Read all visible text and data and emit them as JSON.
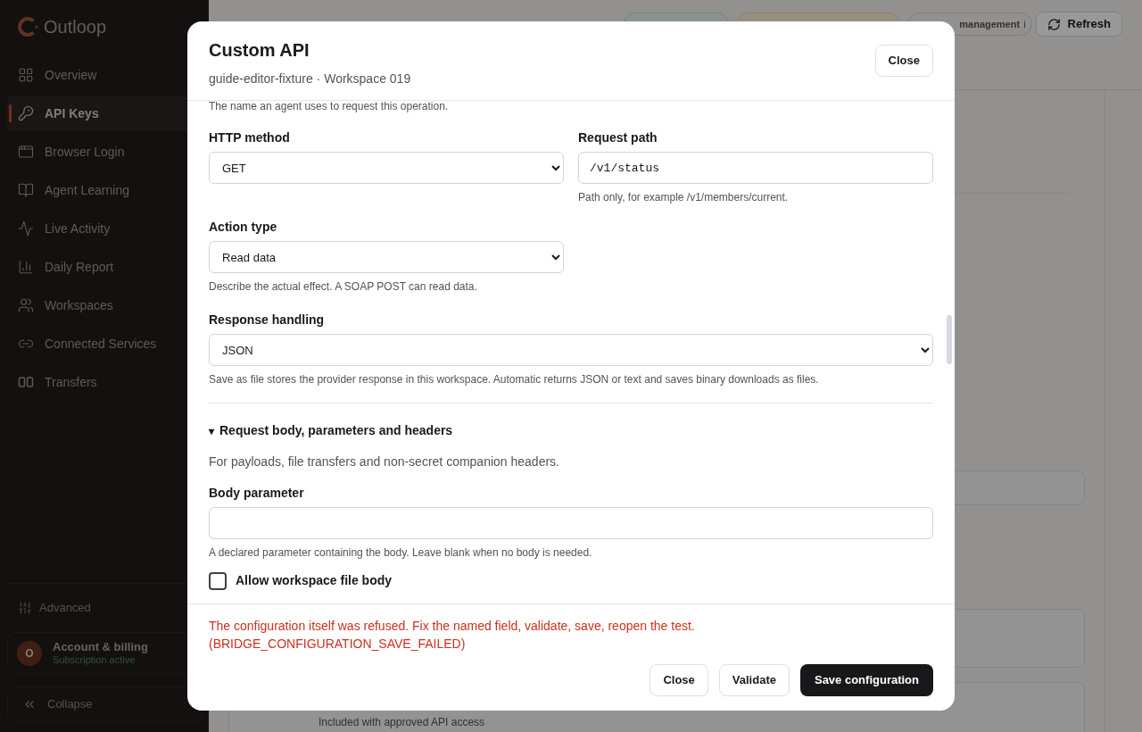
{
  "sidebar": {
    "logo": "Outloop",
    "items": [
      {
        "label": "Overview",
        "selected": false
      },
      {
        "label": "API Keys",
        "selected": true
      },
      {
        "label": "Browser Login",
        "selected": false
      },
      {
        "label": "Agent Learning",
        "selected": false
      },
      {
        "label": "Live Activity",
        "selected": false
      },
      {
        "label": "Daily Report",
        "selected": false
      },
      {
        "label": "Workspaces",
        "selected": false
      },
      {
        "label": "Connected Services",
        "selected": false
      },
      {
        "label": "Transfers",
        "selected": false
      }
    ],
    "advanced": "Advanced",
    "account": {
      "initial": "O",
      "name": "Account & billing",
      "status": "Subscription active"
    },
    "collapse": "Collapse"
  },
  "page": {
    "badge": "management",
    "badge_info": "i",
    "refresh": "Refresh",
    "note": "Included with approved API access"
  },
  "dialog": {
    "title": "Custom API",
    "subtitle": "guide-editor-fixture · Workspace 019",
    "close": "Close",
    "top_hint": "The name an agent uses to request this operation.",
    "method": {
      "label": "HTTP method",
      "value": "GET"
    },
    "path": {
      "label": "Request path",
      "value": "/v1/status",
      "hint": "Path only, for example /v1/members/current."
    },
    "action_type": {
      "label": "Action type",
      "value": "Read data",
      "hint": "Describe the actual effect. A SOAP POST can read data."
    },
    "response": {
      "label": "Response handling",
      "value": "JSON",
      "hint": "Save as file stores the provider response in this workspace. Automatic returns JSON or text and saves binary downloads as files."
    },
    "section": {
      "marker": "▾",
      "label": "Request body, parameters and headers",
      "expanded": true,
      "description": "For payloads, file transfers and non-secret companion headers."
    },
    "body_parameter": {
      "label": "Body parameter",
      "hint": "A declared parameter containing the body. Leave blank when no body is needed."
    },
    "allow_file_body": {
      "label": "Allow workspace file body",
      "checked": false
    },
    "error": "The configuration itself was refused. Fix the named field, validate, save, reopen the test. (BRIDGE_CONFIGURATION_SAVE_FAILED)",
    "buttons": {
      "close": "Close",
      "validate": "Validate",
      "save": "Save configuration"
    }
  }
}
